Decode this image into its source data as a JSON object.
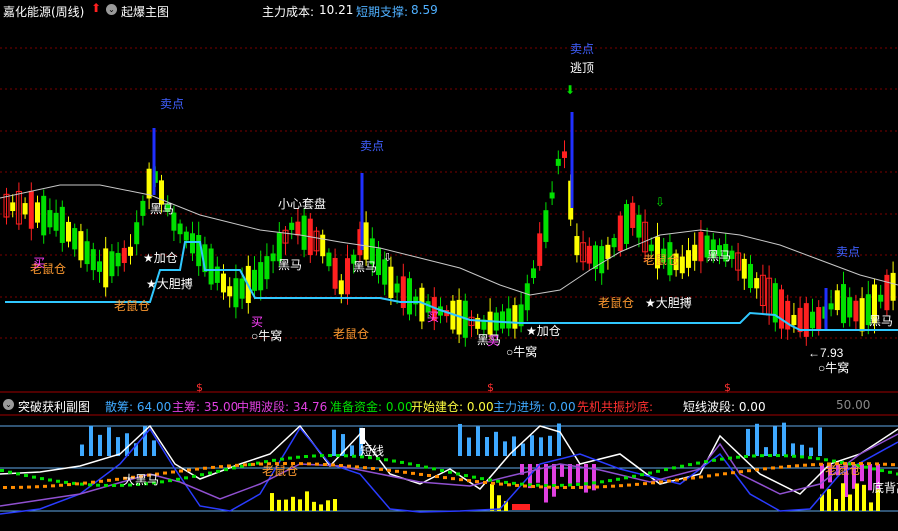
{
  "header": {
    "stock_name": "嘉化能源(周线)",
    "main_indicator": "起爆主图",
    "main_cost_label": "主力成本: ",
    "main_cost_value": "10.21",
    "support_label": "短期支撑: ",
    "support_value": "8.59"
  },
  "sub_header": {
    "indicator_name": "突破获利副图",
    "items": [
      {
        "label": "散筹: ",
        "value": "64.00",
        "color": "#3fa9ff"
      },
      {
        "label": "主筹: ",
        "value": "35.00",
        "color": "#e040e0"
      },
      {
        "label": "中期波段: ",
        "value": "34.76",
        "color": "#e040e0"
      },
      {
        "label": "准备资金: ",
        "value": "0.00",
        "color": "#00e000"
      },
      {
        "label": "开始建仓: ",
        "value": "0.00",
        "color": "#ffff40"
      },
      {
        "label": "主力进场: ",
        "value": "0.00",
        "color": "#3fa9ff"
      },
      {
        "label": "先机共振抄底: ",
        "value": "",
        "color": "#ff3030"
      },
      {
        "label": "短线波段: ",
        "value": "0.00",
        "color": "#ffffff"
      }
    ],
    "right_value": "50.00"
  },
  "annotations": [
    {
      "text": "卖点",
      "color": "#4060ff",
      "kind": "sell"
    },
    {
      "text": "卖点",
      "color": "#4060ff",
      "kind": "sell"
    },
    {
      "text": "卖点",
      "color": "#4060ff",
      "kind": "sell"
    },
    {
      "text": "卖点",
      "color": "#4060ff",
      "kind": "sell"
    },
    {
      "text": "逃顶",
      "color": "#ffffff",
      "kind": "escape"
    },
    {
      "text": "小心套盘",
      "color": "#ffffff",
      "kind": "warn"
    },
    {
      "text": "黑马",
      "color": "#ffffff",
      "kind": "dark-horse"
    },
    {
      "text": "黑马",
      "color": "#ffffff",
      "kind": "dark-horse"
    },
    {
      "text": "黑马",
      "color": "#ffffff",
      "kind": "dark-horse"
    },
    {
      "text": "黑马",
      "color": "#ffffff",
      "kind": "dark-horse"
    },
    {
      "text": "黑马",
      "color": "#ffffff",
      "kind": "dark-horse"
    },
    {
      "text": "黑马",
      "color": "#ffffff",
      "kind": "dark-horse"
    },
    {
      "text": "老鼠仓",
      "color": "#ff9a30",
      "kind": "rat"
    },
    {
      "text": "老鼠仓",
      "color": "#ff9a30",
      "kind": "rat"
    },
    {
      "text": "老鼠仓",
      "color": "#ff9a30",
      "kind": "rat"
    },
    {
      "text": "老鼠仓",
      "color": "#ff9a30",
      "kind": "rat"
    },
    {
      "text": "老鼠仓",
      "color": "#ff9a30",
      "kind": "rat"
    },
    {
      "text": "★加仓",
      "color": "#ffffff",
      "kind": "add"
    },
    {
      "text": "★加仓",
      "color": "#ffffff",
      "kind": "add"
    },
    {
      "text": "★大胆搏",
      "color": "#ffffff",
      "kind": "bold"
    },
    {
      "text": "★大胆搏",
      "color": "#ffffff",
      "kind": "bold"
    },
    {
      "text": "买",
      "color": "#ff40ff",
      "kind": "buy"
    },
    {
      "text": "买",
      "color": "#ff40ff",
      "kind": "buy"
    },
    {
      "text": "买",
      "color": "#ff40ff",
      "kind": "buy"
    },
    {
      "text": "买",
      "color": "#ff40ff",
      "kind": "buy"
    },
    {
      "text": "○牛窝",
      "color": "#ffffff",
      "kind": "nest"
    },
    {
      "text": "○牛窝",
      "color": "#ffffff",
      "kind": "nest"
    },
    {
      "text": "○牛窝",
      "color": "#ffffff",
      "kind": "nest"
    },
    {
      "text": "←7.93",
      "color": "#ffffff",
      "kind": "low"
    }
  ],
  "sub_annotations": [
    {
      "text": "大黑马",
      "color": "#ffffff"
    },
    {
      "text": "老鼠仓",
      "color": "#ff9a30"
    },
    {
      "text": "短线",
      "color": "#ffffff"
    },
    {
      "text": "老鼠仓",
      "color": "#ff9a30"
    },
    {
      "text": "底背离",
      "color": "#ffffff"
    }
  ],
  "sub_markers": [
    "$",
    "$",
    "$"
  ],
  "colors": {
    "up_red": "#ff2020",
    "up_yellow": "#ffff00",
    "down_green": "#00e000",
    "support_cyan": "#30c8ff",
    "ma_white": "#c8c8c8",
    "grid_red": "#7a0000",
    "blue_bar": "#3fa9ff",
    "magenta": "#e040e0",
    "orange": "#ff8c00"
  },
  "icons": [
    "red-up-arrow-icon",
    "circle-chevron-icon",
    "green-down-arrow-icon",
    "hollow-down-arrow-icon"
  ]
}
